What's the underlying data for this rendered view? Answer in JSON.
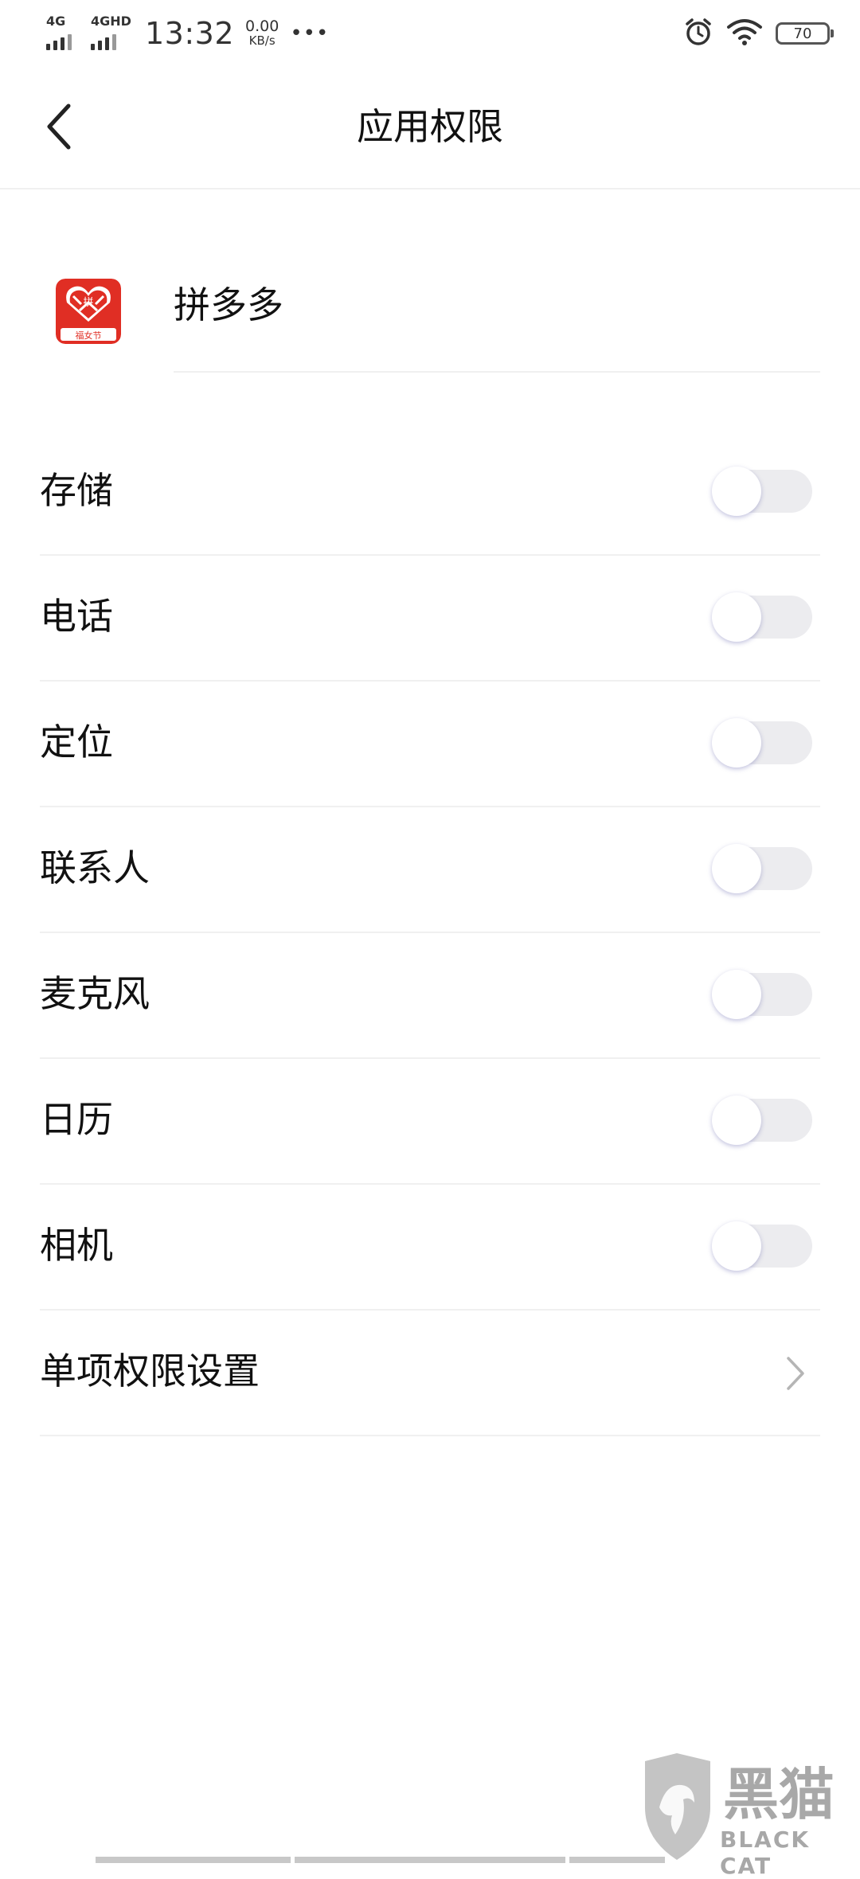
{
  "status_bar": {
    "network1": "4G",
    "network2": "4GHD",
    "time": "13:32",
    "speed_value": "0.00",
    "speed_unit": "KB/s",
    "more": "•••",
    "battery_level": "70",
    "icons": [
      "alarm-icon",
      "wifi-icon",
      "battery-icon"
    ]
  },
  "header": {
    "title": "应用权限",
    "back_icon": "chevron-left-icon"
  },
  "app": {
    "name": "拼多多",
    "icon_caption": "福女节",
    "icon_text": "拼",
    "brand_color": "#e02e24"
  },
  "permissions": [
    {
      "label": "存储",
      "enabled": false
    },
    {
      "label": "电话",
      "enabled": false
    },
    {
      "label": "定位",
      "enabled": false
    },
    {
      "label": "联系人",
      "enabled": false
    },
    {
      "label": "麦克风",
      "enabled": false
    },
    {
      "label": "日历",
      "enabled": false
    },
    {
      "label": "相机",
      "enabled": false
    }
  ],
  "single_permission": {
    "label": "单项权限设置",
    "icon": "chevron-right-icon"
  },
  "watermark": {
    "text_cn": "黑猫",
    "text_en": "BLACK CAT"
  },
  "colors": {
    "toggle_track": "#ececef",
    "toggle_knob": "#ffffff",
    "divider": "#f0f0f0"
  }
}
